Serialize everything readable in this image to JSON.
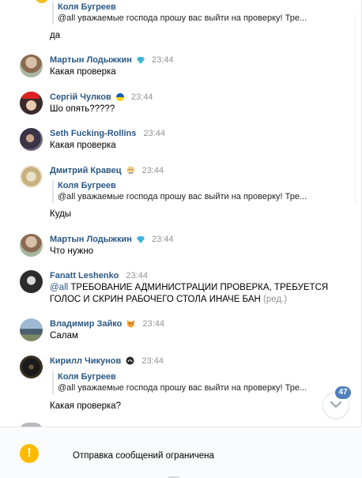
{
  "messages": [
    {
      "quote": {
        "author": "Коля Бугреев",
        "text": "@all уважаемые господа прошу вас выйти на проверку! Тре..."
      },
      "text": "да"
    },
    {
      "author": "Мартын Лодыжкин",
      "time": "23:44",
      "text": "Какая проверка"
    },
    {
      "author": "Сергій Чулков",
      "time": "23:44",
      "text": "Шо опять?????"
    },
    {
      "author": "Seth Fucking-Rollins",
      "time": "23:44",
      "text": "Какая проверка"
    },
    {
      "author": "Дмитрий Кравец",
      "time": "23:44",
      "quote": {
        "author": "Коля Бугреев",
        "text": "@all уважаемые господа прошу вас выйти на проверку! Тре..."
      },
      "text": "Куды"
    },
    {
      "author": "Мартын Лодыжкин",
      "time": "23:44",
      "text": "Что нужно"
    },
    {
      "author": "Fanatt Leshenko",
      "time": "23:44",
      "mention": "@all",
      "line1": " ТРЕБОВАНИЕ АДМИНИСТРАЦИИ ПРОВЕРКА, ТРЕБУЕТСЯ",
      "line2": "ГОЛОС И СКРИН РАБОЧЕГО СТОЛА ИНАЧЕ БАН",
      "edited": "(ред.)"
    },
    {
      "author": "Владимир Зайко",
      "time": "23:44",
      "text": "Салам"
    },
    {
      "author": "Кирилл Чикунов",
      "time": "23:44",
      "quote": {
        "author": "Коля Бугреев",
        "text": "@all уважаемые господа прошу вас выйти на проверку! Тре..."
      },
      "text": "Какая проверка?"
    }
  ],
  "unread_count": "47",
  "bottom_bar": {
    "text": "Отправка сообщений ограничена",
    "icon_glyph": "!"
  },
  "icons": {
    "scroll_down": "chevron-down-icon",
    "warning": "warning-icon"
  },
  "colors": {
    "link": "#2a5885",
    "badge": "#5181b8",
    "warning": "#ffbb00"
  }
}
